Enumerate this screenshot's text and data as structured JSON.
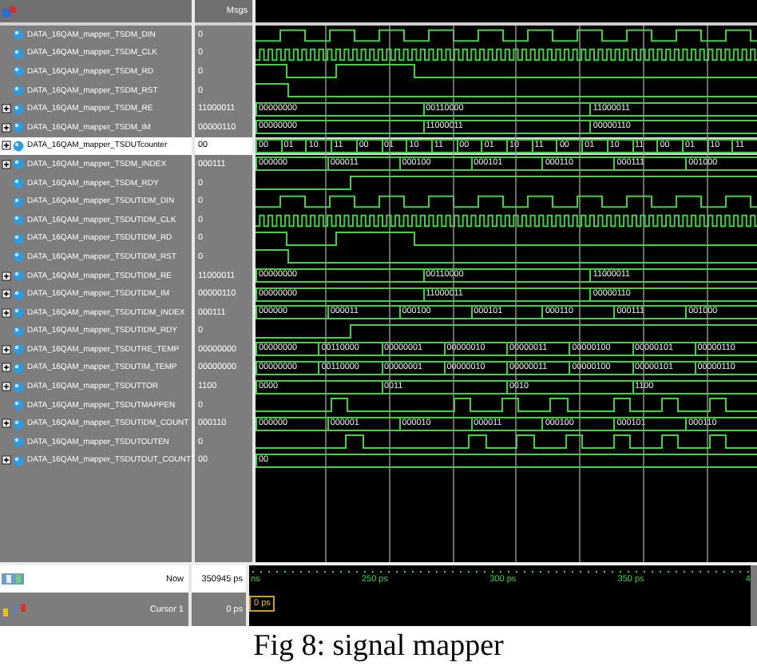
{
  "header": {
    "values_title": "Msgs"
  },
  "signals": [
    {
      "name": "DATA_16QAM_mapper_TSDM_DIN",
      "value": "0",
      "kind": "clock",
      "fast": false,
      "selected": false
    },
    {
      "name": "DATA_16QAM_mapper_TSDM_CLK",
      "value": "0",
      "kind": "clock",
      "fast": true,
      "selected": false
    },
    {
      "name": "DATA_16QAM_mapper_TSDM_RD",
      "value": "0",
      "kind": "bit",
      "high": [
        true,
        true,
        false,
        false,
        false,
        true,
        true,
        true,
        true,
        true,
        false,
        false,
        false,
        false,
        false,
        false,
        false,
        false,
        false,
        false,
        false,
        false,
        false,
        false,
        false,
        false,
        false,
        false,
        false,
        false,
        false,
        false
      ],
      "selected": false
    },
    {
      "name": "DATA_16QAM_mapper_TSDM_RST",
      "value": "0",
      "kind": "bit",
      "high": [
        true,
        true,
        false,
        false,
        false,
        false,
        false,
        false,
        false,
        false,
        false,
        false,
        false,
        false,
        false,
        false,
        false,
        false,
        false,
        false,
        false,
        false,
        false,
        false,
        false,
        false,
        false,
        false,
        false,
        false,
        false,
        false
      ],
      "selected": false
    },
    {
      "name": "DATA_16QAM_mapper_TSDM_RE",
      "value": "11000011",
      "kind": "bus",
      "expanded": false,
      "segments": [
        "00000000",
        "00110000",
        "11000011"
      ],
      "selected": false
    },
    {
      "name": "DATA_16QAM_mapper_TSDM_IM",
      "value": "00000110",
      "kind": "bus",
      "expanded": false,
      "segments": [
        "00000000",
        "11000011",
        "00000110"
      ],
      "selected": false
    },
    {
      "name": "DATA_16QAM_mapper_TSDUTcounter",
      "value": "00",
      "kind": "bus",
      "expanded": false,
      "segments": [
        "00",
        "01",
        "10",
        "11",
        "00",
        "01",
        "10",
        "11",
        "00",
        "01",
        "10",
        "11",
        "00",
        "01",
        "10",
        "11",
        "00",
        "01",
        "10",
        "11"
      ],
      "selected": true
    },
    {
      "name": "DATA_16QAM_mapper_TSDM_INDEX",
      "value": "000111",
      "kind": "bus",
      "expanded": false,
      "segments": [
        "000000",
        "000011",
        "000100",
        "000101",
        "000110",
        "000111",
        "001000"
      ],
      "selected": false
    },
    {
      "name": "DATA_16QAM_mapper_TSDM_RDY",
      "value": "0",
      "kind": "bit",
      "high": [
        false,
        false,
        false,
        false,
        false,
        false,
        true,
        true,
        true,
        true,
        true,
        true,
        true,
        true,
        true,
        true,
        true,
        true,
        true,
        true,
        true,
        true,
        true,
        true,
        true,
        true,
        true,
        true,
        true,
        true,
        true,
        true
      ],
      "selected": false
    },
    {
      "name": "DATA_16QAM_mapper_TSDUTIDM_DIN",
      "value": "0",
      "kind": "clock",
      "fast": false,
      "selected": false
    },
    {
      "name": "DATA_16QAM_mapper_TSDUTIDM_CLK",
      "value": "0",
      "kind": "clock",
      "fast": true,
      "selected": false
    },
    {
      "name": "DATA_16QAM_mapper_TSDUTIDM_RD",
      "value": "0",
      "kind": "bit",
      "high": [
        true,
        true,
        false,
        false,
        false,
        true,
        true,
        true,
        true,
        true,
        false,
        false,
        false,
        false,
        false,
        false,
        false,
        false,
        false,
        false,
        false,
        false,
        false,
        false,
        false,
        false,
        false,
        false,
        false,
        false,
        false,
        false
      ],
      "selected": false
    },
    {
      "name": "DATA_16QAM_mapper_TSDUTIDM_RST",
      "value": "0",
      "kind": "bit",
      "high": [
        true,
        true,
        false,
        false,
        false,
        false,
        false,
        false,
        false,
        false,
        false,
        false,
        false,
        false,
        false,
        false,
        false,
        false,
        false,
        false,
        false,
        false,
        false,
        false,
        false,
        false,
        false,
        false,
        false,
        false,
        false,
        false
      ],
      "selected": false
    },
    {
      "name": "DATA_16QAM_mapper_TSDUTIDM_RE",
      "value": "11000011",
      "kind": "bus",
      "expanded": false,
      "segments": [
        "00000000",
        "00110000",
        "11000011"
      ],
      "selected": false
    },
    {
      "name": "DATA_16QAM_mapper_TSDUTIDM_IM",
      "value": "00000110",
      "kind": "bus",
      "expanded": false,
      "segments": [
        "00000000",
        "11000011",
        "00000110"
      ],
      "selected": false
    },
    {
      "name": "DATA_16QAM_mapper_TSDUTIDM_INDEX",
      "value": "000111",
      "kind": "bus",
      "expanded": false,
      "segments": [
        "000000",
        "000011",
        "000100",
        "000101",
        "000110",
        "000111",
        "001000"
      ],
      "selected": false
    },
    {
      "name": "DATA_16QAM_mapper_TSDUTIDM_RDY",
      "value": "0",
      "kind": "bit",
      "high": [
        false,
        false,
        false,
        false,
        false,
        false,
        true,
        true,
        true,
        true,
        true,
        true,
        true,
        true,
        true,
        true,
        true,
        true,
        true,
        true,
        true,
        true,
        true,
        true,
        true,
        true,
        true,
        true,
        true,
        true,
        true,
        true
      ],
      "selected": false
    },
    {
      "name": "DATA_16QAM_mapper_TSDUTRE_TEMP",
      "value": "00000000",
      "kind": "bus",
      "expanded": false,
      "segments": [
        "00000000",
        "00110000",
        "00000001",
        "00000010",
        "00000011",
        "00000100",
        "00000101",
        "00000110"
      ],
      "selected": false
    },
    {
      "name": "DATA_16QAM_mapper_TSDUTIM_TEMP",
      "value": "00000000",
      "kind": "bus",
      "expanded": false,
      "segments": [
        "00000000",
        "00110000",
        "00000001",
        "00000010",
        "00000011",
        "00000100",
        "00000101",
        "00000110"
      ],
      "selected": false
    },
    {
      "name": "DATA_16QAM_mapper_TSDUTTOR",
      "value": "1100",
      "kind": "bus",
      "expanded": false,
      "segments": [
        "0000",
        "0011",
        "0010",
        "1100"
      ],
      "selected": false
    },
    {
      "name": "DATA_16QAM_mapper_TSDUTMAPPEN",
      "value": "0",
      "kind": "bit",
      "high": [
        false,
        false,
        false,
        false,
        false,
        true,
        false,
        false,
        false,
        false,
        false,
        false,
        false,
        true,
        false,
        false,
        true,
        false,
        false,
        true,
        false,
        false,
        false,
        true,
        false,
        false,
        true,
        false,
        false,
        true,
        false,
        false
      ],
      "selected": false
    },
    {
      "name": "DATA_16QAM_mapper_TSDUTIDM_COUNT",
      "value": "000110",
      "kind": "bus",
      "expanded": false,
      "segments": [
        "000000",
        "000001",
        "000010",
        "000011",
        "000100",
        "000101",
        "000110"
      ],
      "selected": false
    },
    {
      "name": "DATA_16QAM_mapper_TSDUTOUTEN",
      "value": "0",
      "kind": "bit",
      "high": [
        false,
        false,
        false,
        false,
        false,
        false,
        true,
        false,
        false,
        false,
        false,
        false,
        false,
        false,
        true,
        false,
        false,
        true,
        false,
        false,
        true,
        false,
        false,
        true,
        false,
        false,
        true,
        false,
        false,
        true,
        false,
        false
      ],
      "selected": false
    },
    {
      "name": "DATA_16QAM_mapper_TSDUTOUT_COUNT",
      "value": "00",
      "kind": "bus",
      "expanded": false,
      "segments": [
        "00"
      ],
      "selected": false
    }
  ],
  "now": {
    "label": "Now",
    "value": "350945 ps"
  },
  "timeline": {
    "ticks": [
      "ns",
      "250 ps",
      "300 ps",
      "350 ps",
      "4"
    ]
  },
  "cursor": {
    "label": "Cursor 1",
    "value": "0 ps",
    "marker": "0 ps"
  },
  "caption": "Fig 8: signal mapper"
}
